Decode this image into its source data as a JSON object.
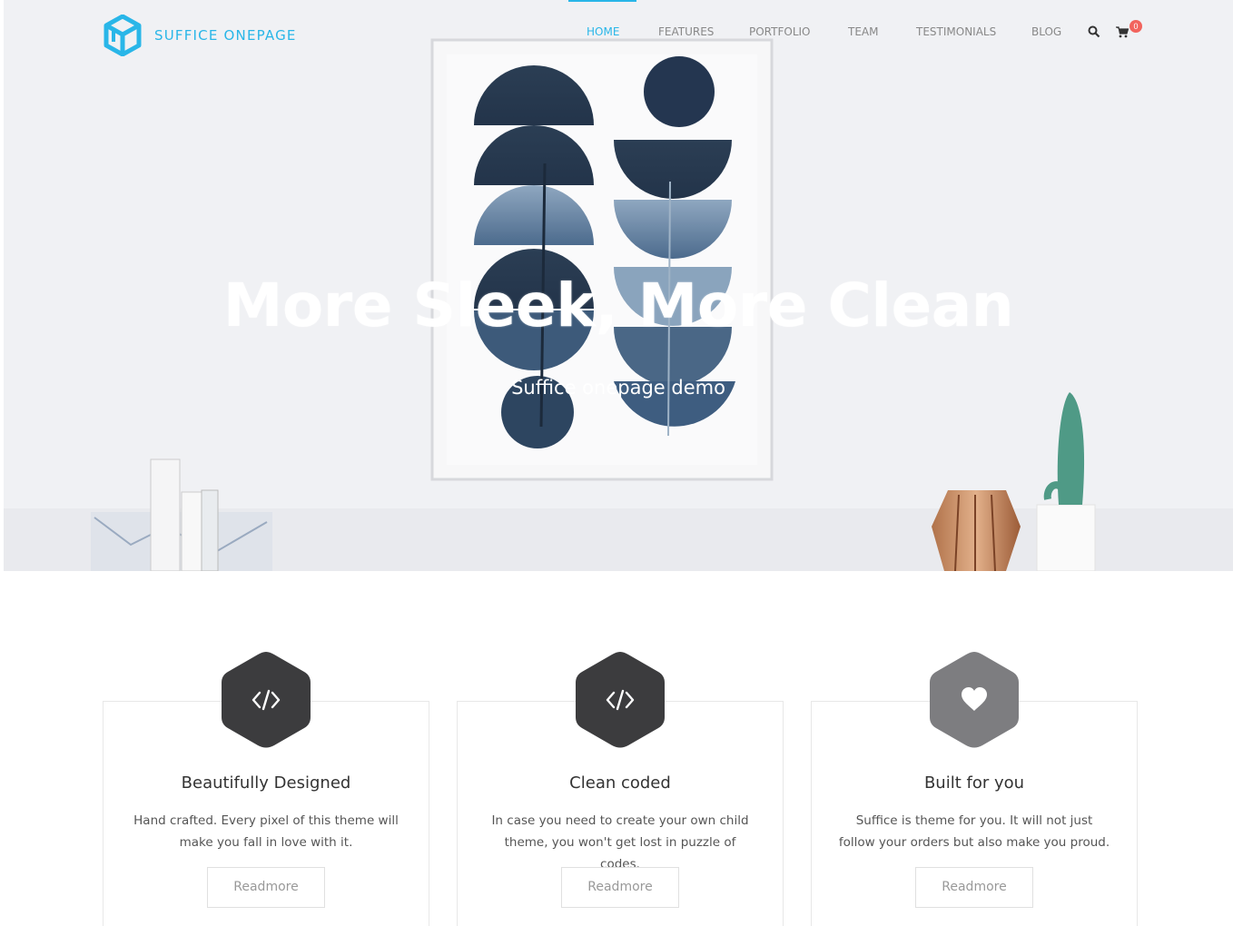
{
  "header": {
    "logo_text_1": "SUFFICE",
    "logo_text_2": "ONEPAGE",
    "nav": [
      {
        "label": "HOME",
        "active": true
      },
      {
        "label": "FEATURES",
        "active": false
      },
      {
        "label": "PORTFOLIO",
        "active": false
      },
      {
        "label": "TEAM",
        "active": false
      },
      {
        "label": "TESTIMONIALS",
        "active": false
      },
      {
        "label": "BLOG",
        "active": false
      }
    ],
    "cart_count": "0",
    "accent_color": "#29b6e8"
  },
  "hero": {
    "title": "More Sleek, More Clean",
    "subtitle": "Suffice onepage demo"
  },
  "features": [
    {
      "icon": "code-icon",
      "title": "Beautifully Designed",
      "text": "Hand crafted. Every pixel of this theme will make you fall in love with it.",
      "button": "Readmore"
    },
    {
      "icon": "code-icon",
      "title": "Clean coded",
      "text": "In case you need to create your own child theme, you won't get lost in puzzle of codes.",
      "button": "Readmore"
    },
    {
      "icon": "heart-icon",
      "title": "Built for you",
      "text": "Suffice is theme for you. It will not just follow your orders but also make you proud.",
      "button": "Readmore"
    }
  ]
}
